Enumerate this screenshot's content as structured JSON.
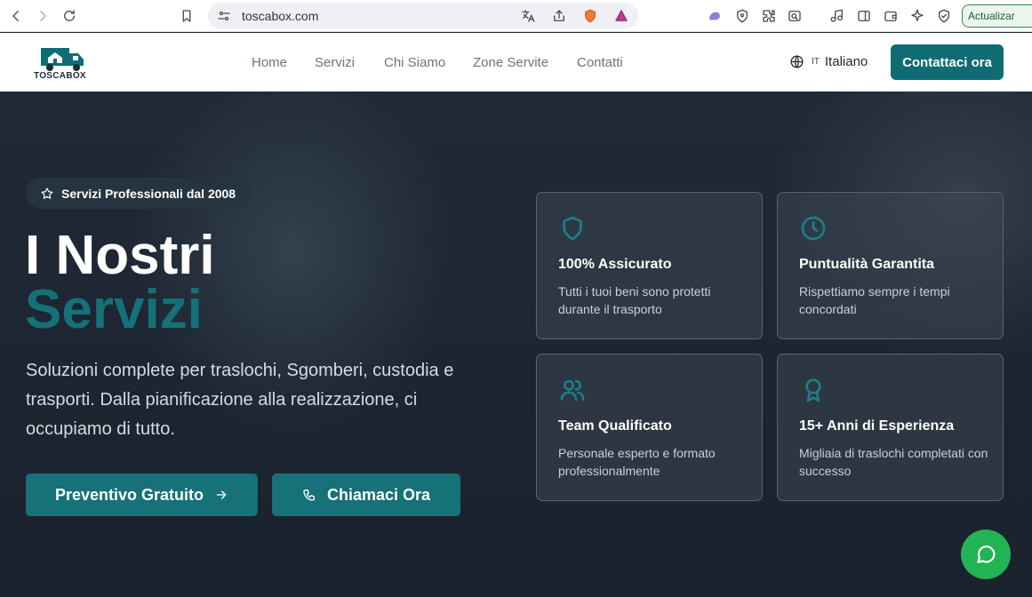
{
  "browser": {
    "url": "toscabox.com",
    "update_label": "Actualizar"
  },
  "header": {
    "logo_text": "TOSCABOX",
    "nav": [
      "Home",
      "Servizi",
      "Chi Siamo",
      "Zone Servite",
      "Contatti"
    ],
    "lang_code": "IT",
    "lang_label": "Italiano",
    "cta_label": "Contattaci ora"
  },
  "hero": {
    "badge": "Servizi Professionali dal 2008",
    "title_line1": "I Nostri",
    "title_line2": "Servizi",
    "lead": "Soluzioni complete per traslochi, Sgomberi, custodia e trasporti. Dalla pianificazione alla realizzazione, ci occupiamo di tutto.",
    "btn_primary": "Preventivo Gratuito",
    "btn_secondary": "Chiamaci Ora"
  },
  "features": [
    {
      "icon": "shield-icon",
      "title": "100% Assicurato",
      "desc": "Tutti i tuoi beni sono protetti durante il trasporto"
    },
    {
      "icon": "clock-icon",
      "title": "Puntualità Garantita",
      "desc": "Rispettiamo sempre i tempi concordati"
    },
    {
      "icon": "users-icon",
      "title": "Team Qualificato",
      "desc": "Personale esperto e formato professionalmente"
    },
    {
      "icon": "award-icon",
      "title": "15+ Anni di Esperienza",
      "desc": "Migliaia di traslochi completati con successo"
    }
  ],
  "colors": {
    "accent": "#0f6c73",
    "whatsapp": "#22b355"
  }
}
